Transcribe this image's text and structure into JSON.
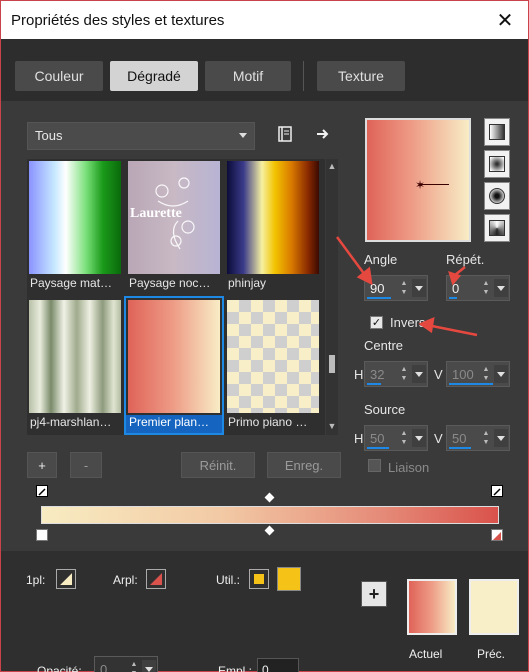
{
  "window": {
    "title": "Propriétés des styles et textures",
    "close_glyph": "✕"
  },
  "tabs": [
    {
      "label": "Couleur",
      "active": false
    },
    {
      "label": "Dégradé",
      "active": true
    },
    {
      "label": "Motif",
      "active": false
    },
    {
      "label": "Texture",
      "active": false
    }
  ],
  "library": {
    "category": "Tous",
    "icons": {
      "book": "book-icon",
      "next": "arrow-right-icon"
    },
    "thumbnails": [
      {
        "label": "Paysage mat…",
        "selected": false
      },
      {
        "label": "Paysage noc…",
        "watermark": "Laurette",
        "selected": false
      },
      {
        "label": "phinjay",
        "selected": false
      },
      {
        "label": "pj4-marshlan…",
        "selected": false
      },
      {
        "label": "Premier plan…",
        "selected": true
      },
      {
        "label": "Primo piano …",
        "selected": false
      }
    ],
    "buttons": {
      "add": "+",
      "remove": "-",
      "reset": "Réinit.",
      "save": "Enreg."
    }
  },
  "settings": {
    "angle_label": "Angle",
    "angle_value": "90",
    "repeats_label": "Répét.",
    "repeats_value": "0",
    "invert_label": "Invers",
    "invert_checked": true,
    "center_label": "Centre",
    "center_h_label": "H",
    "center_h": "32",
    "center_v_label": "V",
    "center_v": "100",
    "source_label": "Source",
    "source_h_label": "H",
    "source_h": "50",
    "source_v_label": "V",
    "source_v": "50",
    "link_label": "Liaison",
    "link_checked": false
  },
  "bottom": {
    "fg_label": "1pl:",
    "bg_label": "Arpl:",
    "user_label": "Util.:",
    "opacity_label": "Opacité:",
    "opacity_value": "0",
    "location_label": "Empl.:",
    "location_value": "0",
    "add_glyph": "+",
    "current_label": "Actuel",
    "previous_label": "Préc."
  },
  "colors": {
    "gradient_start": "#df6358",
    "gradient_end": "#f8edc6",
    "user_color": "#f5c218",
    "accent": "#1e88e5",
    "annotation_arrow": "#e5483f",
    "window_border": "#c9434a"
  }
}
